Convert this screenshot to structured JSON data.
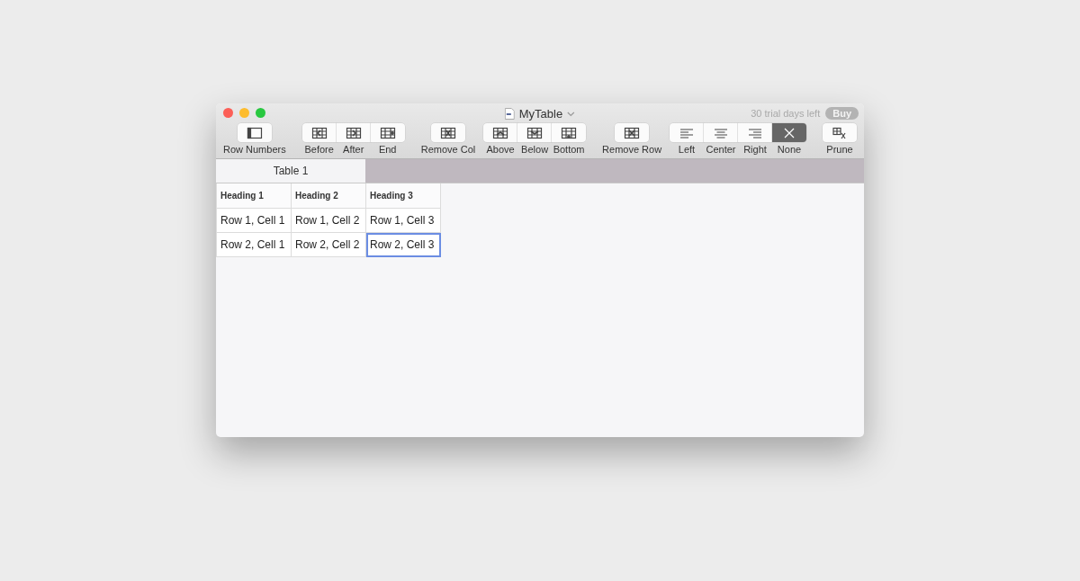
{
  "window": {
    "title": "MyTable",
    "trial_notice": "30 trial days left",
    "buy_button": "Buy"
  },
  "toolbar": {
    "sections": [
      {
        "groups": [
          {
            "buttons": [
              {
                "label": "Row Numbers",
                "kind": "row-numbers",
                "selected": false
              }
            ]
          },
          {
            "buttons": [
              {
                "label": "Before",
                "kind": "col-before",
                "selected": false
              },
              {
                "label": "After",
                "kind": "col-after",
                "selected": false
              },
              {
                "label": "End",
                "kind": "col-end",
                "selected": false
              }
            ]
          },
          {
            "buttons": [
              {
                "label": "Remove Col",
                "kind": "remove-col",
                "selected": false
              }
            ]
          }
        ]
      },
      {
        "groups": [
          {
            "buttons": [
              {
                "label": "Above",
                "kind": "row-above",
                "selected": false
              },
              {
                "label": "Below",
                "kind": "row-below",
                "selected": false
              },
              {
                "label": "Bottom",
                "kind": "row-bottom",
                "selected": false
              }
            ]
          },
          {
            "buttons": [
              {
                "label": "Remove Row",
                "kind": "remove-row",
                "selected": false
              }
            ]
          }
        ]
      },
      {
        "groups": [
          {
            "buttons": [
              {
                "label": "Left",
                "kind": "align-left",
                "selected": false
              },
              {
                "label": "Center",
                "kind": "align-center",
                "selected": false
              },
              {
                "label": "Right",
                "kind": "align-right",
                "selected": false
              },
              {
                "label": "None",
                "kind": "align-none",
                "selected": true
              }
            ]
          },
          {
            "buttons": [
              {
                "label": "Prune",
                "kind": "prune",
                "selected": false
              }
            ]
          }
        ]
      }
    ]
  },
  "tabs": [
    {
      "label": "Table 1",
      "selected": true
    }
  ],
  "table": {
    "columns": [
      "Heading 1",
      "Heading 2",
      "Heading 3"
    ],
    "rows": [
      {
        "cells": [
          {
            "text": "Row 1, Cell 1",
            "selected": false
          },
          {
            "text": "Row 1, Cell 2",
            "selected": false
          },
          {
            "text": "Row 1, Cell 3",
            "selected": false
          }
        ]
      },
      {
        "cells": [
          {
            "text": "Row 2, Cell 1",
            "selected": false
          },
          {
            "text": "Row 2, Cell 2",
            "selected": false
          },
          {
            "text": "Row 2, Cell 3",
            "selected": true
          }
        ]
      }
    ]
  }
}
